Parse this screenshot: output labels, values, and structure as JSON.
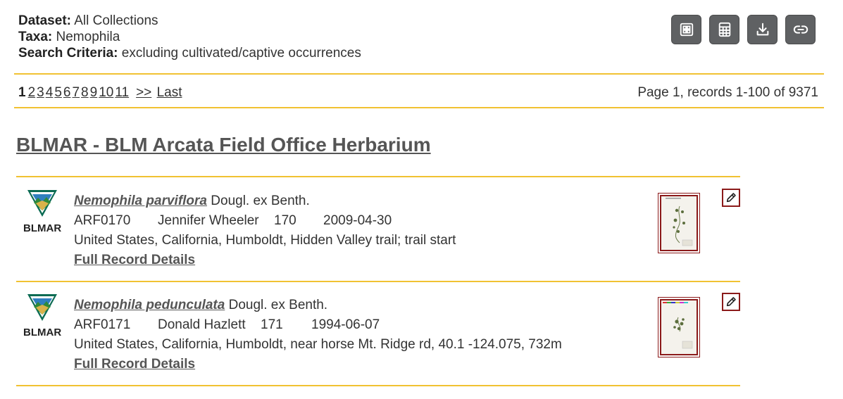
{
  "criteria": {
    "dataset_label": "Dataset:",
    "dataset_value": "All Collections",
    "taxa_label": "Taxa:",
    "taxa_value": "Nemophila",
    "search_label": "Search Criteria:",
    "search_value": "excluding cultivated/captive occurrences"
  },
  "toolbar": {
    "icons": [
      "table-view-icon",
      "calculator-icon",
      "download-icon",
      "link-icon"
    ]
  },
  "pagination": {
    "current": "1",
    "pages": [
      "2",
      "3",
      "4",
      "5",
      "6",
      "7",
      "8",
      "9",
      "10",
      "11"
    ],
    "next": ">>",
    "last": "Last",
    "info": "Page 1, records 1-100 of 9371"
  },
  "collection": {
    "title": "BLMAR - BLM Arcata Field Office Herbarium"
  },
  "records": [
    {
      "logo_code": "BLMAR",
      "sciname": "Nemophila parviflora",
      "author": "Dougl. ex Benth.",
      "catalog": "ARF0170",
      "collector": "Jennifer Wheeler",
      "number": "170",
      "date": "2009-04-30",
      "locality": "United States, California, Humboldt, Hidden Valley trail; trail start",
      "details_label": "Full Record Details"
    },
    {
      "logo_code": "BLMAR",
      "sciname": "Nemophila pedunculata",
      "author": "Dougl. ex Benth.",
      "catalog": "ARF0171",
      "collector": "Donald Hazlett",
      "number": "171",
      "date": "1994-06-07",
      "locality": "United States, California, Humboldt, near horse Mt. Ridge rd, 40.1 -124.075, 732m",
      "details_label": "Full Record Details"
    }
  ],
  "colors": {
    "accent_rule": "#f1c232",
    "button_bg": "#5f6163",
    "thumb_border": "#8b1a1a"
  }
}
